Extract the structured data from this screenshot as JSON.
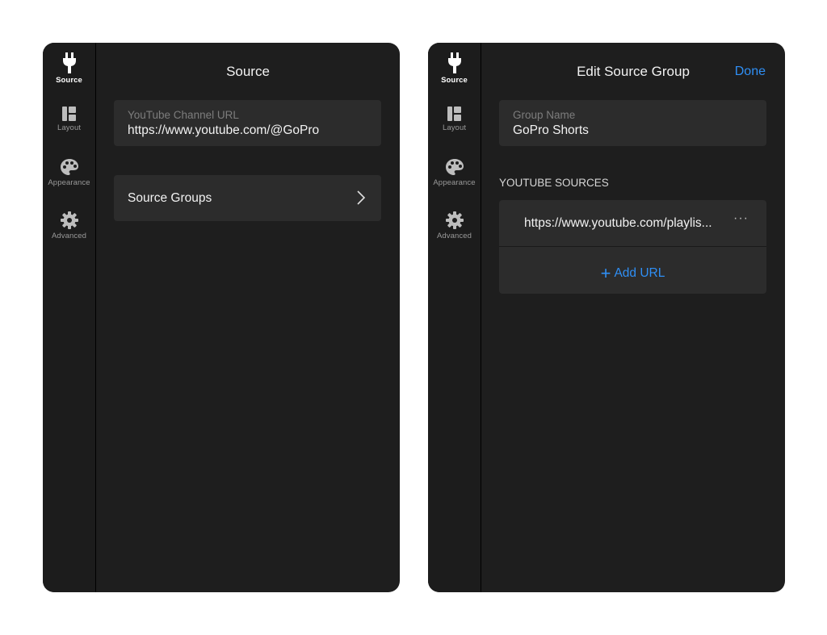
{
  "nav": [
    {
      "label": "Source",
      "icon": "plug-icon"
    },
    {
      "label": "Layout",
      "icon": "layout-icon"
    },
    {
      "label": "Appearance",
      "icon": "palette-icon"
    },
    {
      "label": "Advanced",
      "icon": "gear-icon"
    }
  ],
  "left_panel": {
    "title": "Source",
    "channel_field": {
      "label": "YouTube Channel URL",
      "value": "https://www.youtube.com/@GoPro"
    },
    "source_groups_label": "Source Groups"
  },
  "right_panel": {
    "title": "Edit Source Group",
    "done_label": "Done",
    "group_field": {
      "label": "Group Name",
      "value": "GoPro Shorts"
    },
    "section_header": "YOUTUBE SOURCES",
    "sources": [
      {
        "url": "https://www.youtube.com/playlis..."
      }
    ],
    "more_label": "···",
    "add_url_label": "Add URL",
    "add_url_symbol": "+"
  },
  "colors": {
    "accent": "#2f8ff5",
    "panel_bg": "#1e1e1e",
    "card_bg": "#2c2c2c"
  }
}
